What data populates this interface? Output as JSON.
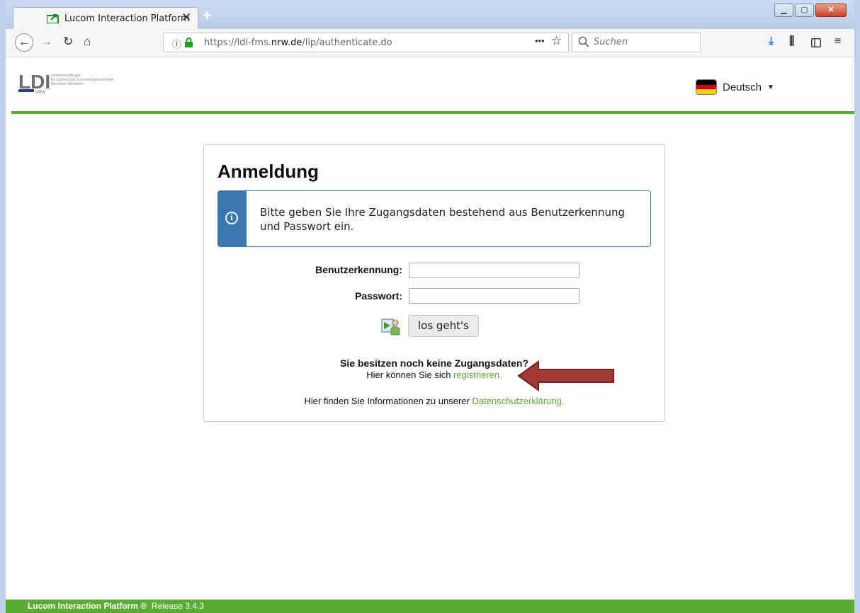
{
  "browser": {
    "tab_title": "Lucom Interaction Platform",
    "url_prefix": "https://ldi-fms.",
    "url_domain": "nrw.de",
    "url_path": "/lip/authenticate.do",
    "search_placeholder": "Suchen",
    "icons": [
      "back-icon",
      "forward-icon",
      "reload-icon",
      "home-icon",
      "info-icon",
      "lock-icon",
      "more-icon",
      "star-icon",
      "search-icon",
      "download-icon",
      "library-icon",
      "sidebar-icon",
      "menu-icon"
    ]
  },
  "header": {
    "logo_text": "LDI",
    "logo_sub": "NRW",
    "logo_line1": "Landesbeauftragte",
    "logo_line2": "für Datenschutz und Informationsfreiheit",
    "logo_line3": "Nordrhein-Westfalen",
    "language": "Deutsch"
  },
  "login": {
    "title": "Anmeldung",
    "info": "Bitte geben Sie Ihre Zugangsdaten bestehend aus Benutzerkennung und Passwort ein.",
    "user_label": "Benutzerkennung:",
    "pass_label": "Passwort:",
    "submit": "los geht's",
    "no_account": "Sie besitzen noch keine Zugangsdaten?",
    "register_prefix": "Hier können Sie sich ",
    "register_link": "registrieren.",
    "privacy_prefix": "Hier finden Sie Informationen zu unserer ",
    "privacy_link": "Datenschutzerklärung."
  },
  "footer": {
    "product": "Lucom Interaction Platform ®",
    "release": "Release 3.4.3"
  },
  "colors": {
    "accent_green": "#5aab31",
    "info_blue": "#3a76b0",
    "arrow_red": "#a23a35"
  }
}
